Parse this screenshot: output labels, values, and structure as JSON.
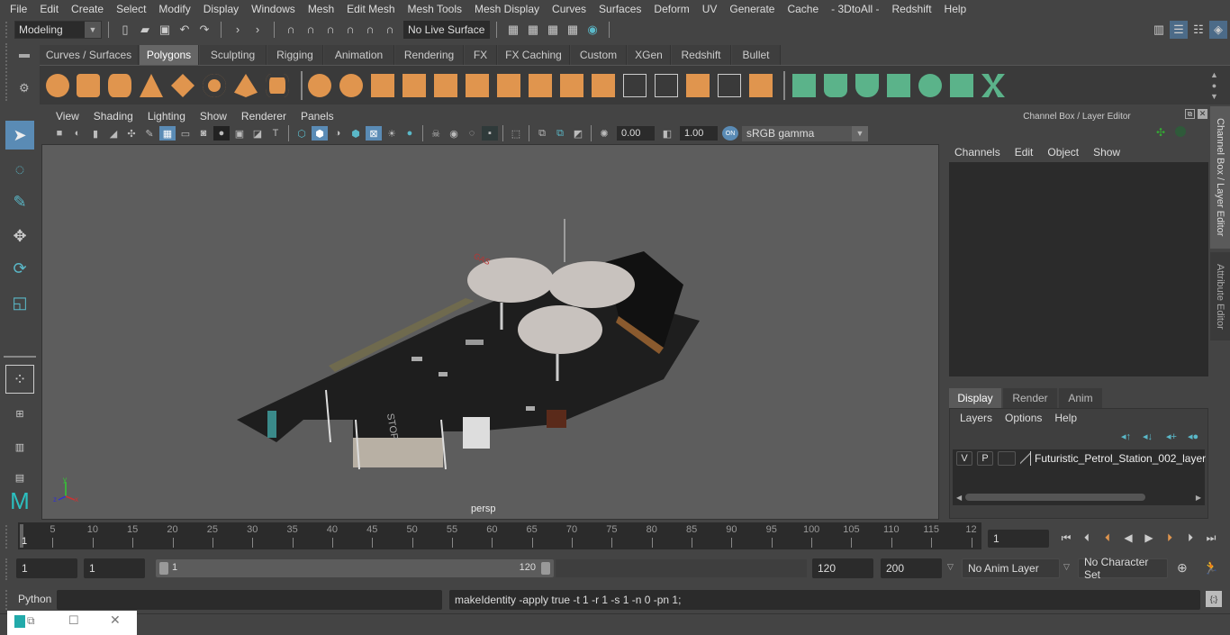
{
  "menubar": {
    "items": [
      "File",
      "Edit",
      "Create",
      "Select",
      "Modify",
      "Display",
      "Windows",
      "Mesh",
      "Edit Mesh",
      "Mesh Tools",
      "Mesh Display",
      "Curves",
      "Surfaces",
      "Deform",
      "UV",
      "Generate",
      "Cache",
      "- 3DtoAll -",
      "Redshift",
      "Help"
    ]
  },
  "status_line": {
    "workspace_menu": "Modeling",
    "live_surface": "No Live Surface"
  },
  "shelf": {
    "tabs": [
      "Curves / Surfaces",
      "Polygons",
      "Sculpting",
      "Rigging",
      "Animation",
      "Rendering",
      "FX",
      "FX Caching",
      "Custom",
      "XGen",
      "Redshift",
      "Bullet"
    ],
    "active_tab": "Polygons",
    "accent_orange": "#e0954e",
    "accent_green": "#5bb38a"
  },
  "viewport": {
    "menu": [
      "View",
      "Shading",
      "Lighting",
      "Show",
      "Renderer",
      "Panels"
    ],
    "exposure": "0.00",
    "gamma": "1.00",
    "color_space": "sRGB gamma",
    "camera_label": "persp",
    "axis": {
      "x": "x",
      "y": "y",
      "z": "z"
    }
  },
  "channel_box": {
    "title": "Channel Box / Layer Editor",
    "menu": [
      "Channels",
      "Edit",
      "Object",
      "Show"
    ]
  },
  "side_tabs": {
    "channel_box": "Channel Box / Layer Editor",
    "attribute_editor": "Attribute Editor"
  },
  "layer_editor": {
    "tabs": [
      "Display",
      "Render",
      "Anim"
    ],
    "active_tab": "Display",
    "menu": [
      "Layers",
      "Options",
      "Help"
    ],
    "layers": [
      {
        "visible": "V",
        "playback": "P",
        "name": "Futuristic_Petrol_Station_002_layer"
      }
    ]
  },
  "timeline": {
    "ticks": [
      "5",
      "10",
      "15",
      "20",
      "25",
      "30",
      "35",
      "40",
      "45",
      "50",
      "55",
      "60",
      "65",
      "70",
      "75",
      "80",
      "85",
      "90",
      "95",
      "100",
      "105",
      "110",
      "115",
      "12"
    ],
    "current_frame_marker": "1",
    "current_frame": "1"
  },
  "range_slider": {
    "start_frame": "1",
    "playback_start": "1",
    "range_start": "1",
    "range_end": "120",
    "playback_end": "120",
    "end_frame": "200",
    "anim_layer": "No Anim Layer",
    "character_set": "No Character Set"
  },
  "command_line": {
    "language": "Python",
    "input": "",
    "result": "makeIdentity -apply true -t 1 -r 1 -s 1 -n 0 -pn 1;"
  }
}
